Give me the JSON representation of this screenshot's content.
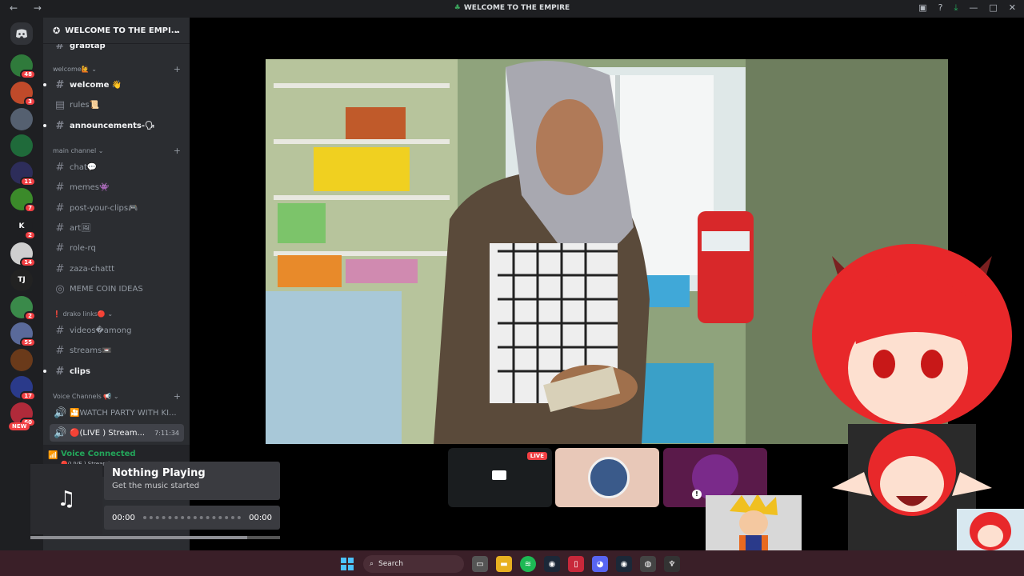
{
  "window": {
    "title": "WELCOME TO THE EMPIRE",
    "nav": "← →"
  },
  "server": {
    "name": "WELCOME TO THE EMPI...",
    "partial_channel": "grabtap"
  },
  "guilds": [
    {
      "badge": "48",
      "color": "#2f7a3b"
    },
    {
      "badge": "3",
      "color": "#c04a2a"
    },
    {
      "badge": "",
      "color": "#556070"
    },
    {
      "badge": "",
      "color": "#1f6a3a"
    },
    {
      "badge": "11",
      "color": "#2d2d5a"
    },
    {
      "badge": "7",
      "color": "#3b8a2a"
    },
    {
      "badge": "2",
      "color": "#1e1f22",
      "text": "K"
    },
    {
      "badge": "14",
      "color": "#cfcfcf"
    },
    {
      "badge": "",
      "color": "#222",
      "text": "TJ"
    },
    {
      "badge": "2",
      "color": "#3a8a4a"
    },
    {
      "badge": "55",
      "color": "#5a6a9a"
    },
    {
      "badge": "",
      "color": "#6a3a1a"
    },
    {
      "badge": "17",
      "color": "#2a3a8a"
    },
    {
      "badge": "60",
      "color": "#b02a3a"
    }
  ],
  "new_badge": "NEW",
  "categories": {
    "welcome": "welcome🙋",
    "main": "main channel",
    "drako": "❗ drako links🔴",
    "voice": "Voice Channels 📢"
  },
  "channels": {
    "welcome": "welcome 👋",
    "rules": "rules📜",
    "announcements": "announcements-🗣",
    "chat": "chat💬",
    "memes": "memes👾",
    "post_clips": "post-your-clips🎮",
    "art": "art🖼",
    "role_rq": "role-rq",
    "zaza": "zaza-chattt",
    "meme_coin": "MEME COIN IDEAS",
    "videos": "videos�among",
    "streams": "streams📼",
    "clips": "clips",
    "watch_party": "🎦WATCH PARTY WITH KI...",
    "live_stream": "🔴(LIVE ) Stream...",
    "live_time": "7:11:34"
  },
  "voice": {
    "status": "Voice Connected",
    "sub": "🔴(LIVE ) Streaming / WELCOME..."
  },
  "music": {
    "title": "Nothing Playing",
    "subtitle": "Get the music started",
    "time_start": "00:00",
    "time_end": "00:00",
    "progress": 0.87
  },
  "tiles": {
    "live_label": "LIVE"
  },
  "taskbar": {
    "search_placeholder": "Search"
  }
}
